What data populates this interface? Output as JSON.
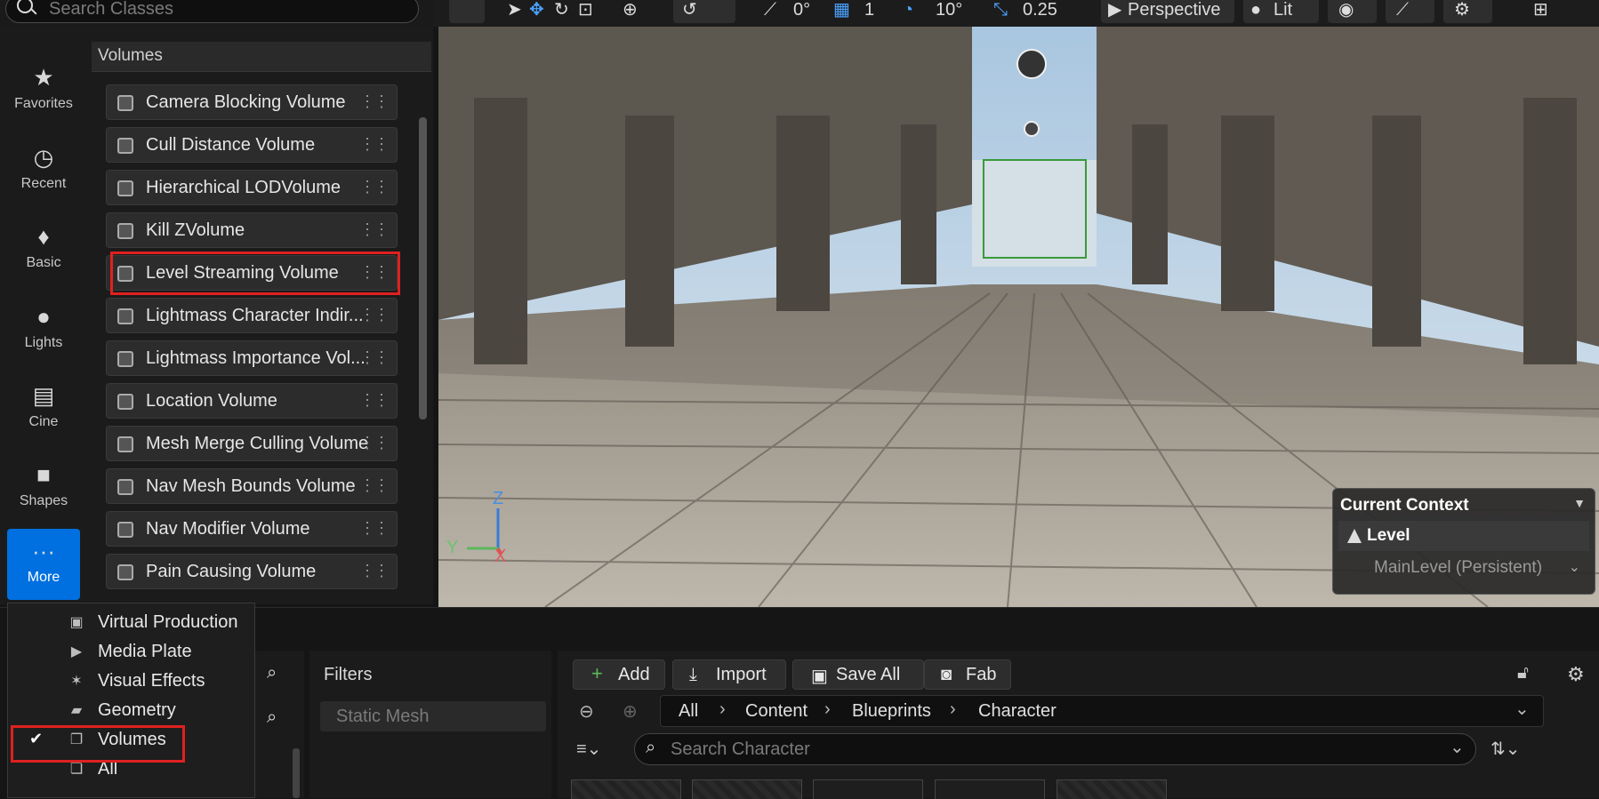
{
  "top_search": {
    "placeholder": "Search Classes"
  },
  "category_rail": {
    "items": [
      {
        "label": "Favorites",
        "icon": "star-icon"
      },
      {
        "label": "Recent",
        "icon": "clock-icon"
      },
      {
        "label": "Basic",
        "icon": "shapes-icon"
      },
      {
        "label": "Lights",
        "icon": "bulb-icon"
      },
      {
        "label": "Cine",
        "icon": "clapper-icon"
      },
      {
        "label": "Shapes",
        "icon": "cube-icon"
      },
      {
        "label": "More",
        "icon": "more-icon"
      }
    ]
  },
  "volumes_panel": {
    "header": "Volumes",
    "items": [
      "Camera Blocking Volume",
      "Cull Distance Volume",
      "Hierarchical LODVolume",
      "Kill ZVolume",
      "Level Streaming Volume",
      "Lightmass Character Indir...",
      "Lightmass Importance Vol...",
      "Location Volume",
      "Mesh Merge Culling Volume",
      "Nav Mesh Bounds Volume",
      "Nav Modifier Volume",
      "Pain Causing Volume"
    ],
    "highlighted": "Level Streaming Volume"
  },
  "viewport_toolbar": {
    "rotation_snap": "0°",
    "grid_snap": "1",
    "angle_snap": "10°",
    "scale_snap": "0.25",
    "view_mode": "Perspective",
    "lighting_mode": "Lit"
  },
  "current_context": {
    "title": "Current Context",
    "level_label": "Level",
    "level_value": "MainLevel (Persistent)"
  },
  "gizmo": {
    "z": "Z",
    "y": "Y",
    "x": "X"
  },
  "dropdown_menu": {
    "items": [
      {
        "label": "Virtual Production",
        "icon": "virtual-production-icon"
      },
      {
        "label": "Media Plate",
        "icon": "media-plate-icon"
      },
      {
        "label": "Visual Effects",
        "icon": "visual-effects-icon"
      },
      {
        "label": "Geometry",
        "icon": "geometry-icon"
      },
      {
        "label": "Volumes",
        "icon": "volumes-icon",
        "checked": true
      },
      {
        "label": "All",
        "icon": "all-icon"
      }
    ]
  },
  "content_browser": {
    "filters_title": "Filters",
    "filter_chip": "Static Mesh",
    "buttons": {
      "add": "Add",
      "import": "Import",
      "save_all": "Save All",
      "fab": "Fab"
    },
    "breadcrumb": [
      "All",
      "Content",
      "Blueprints",
      "Character"
    ],
    "search_placeholder": "Search Character"
  },
  "colors": {
    "accent": "#0070e0",
    "highlight": "#e02020",
    "panel": "#1b1b1b"
  }
}
